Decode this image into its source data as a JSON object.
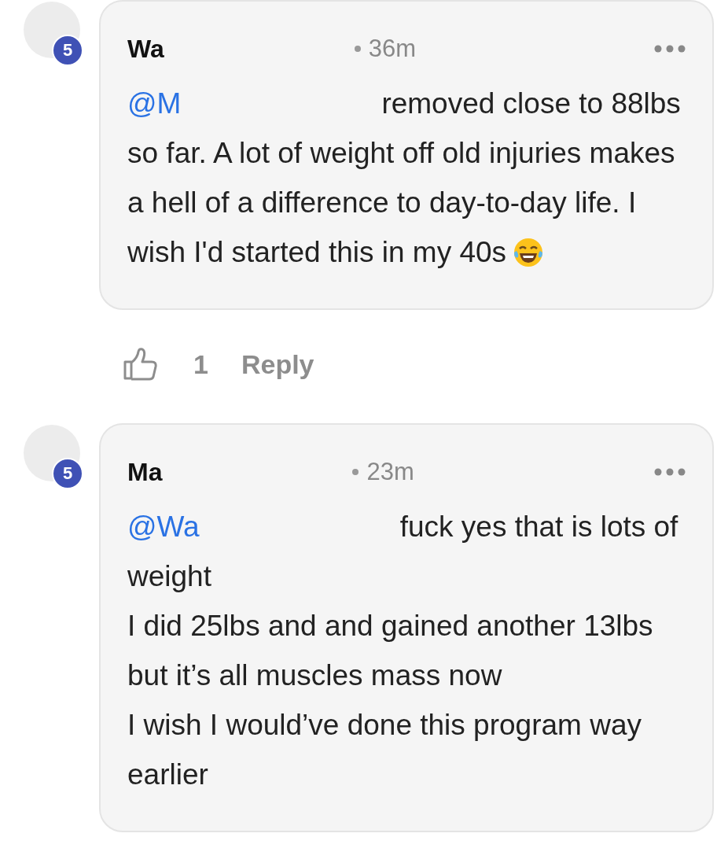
{
  "comments": [
    {
      "badge": "5",
      "name": "Wa",
      "time": "36m",
      "mention": "@M",
      "paragraphs": [
        "removed close to 88lbs so far. A lot of weight off old injuries makes a hell of a difference to day-to-day life. I wish I'd started this in my 40s"
      ],
      "emoji": true,
      "actions": {
        "likes": "1",
        "reply": "Reply"
      }
    },
    {
      "badge": "5",
      "name": "Ma",
      "time": "23m",
      "mention": "@Wa",
      "paragraphs": [
        "fuck yes that is lots of weight",
        "I did 25lbs and and gained another 13lbs but it’s all muscles mass now",
        "I wish I would’ve done this program way earlier"
      ],
      "emoji": false
    }
  ]
}
